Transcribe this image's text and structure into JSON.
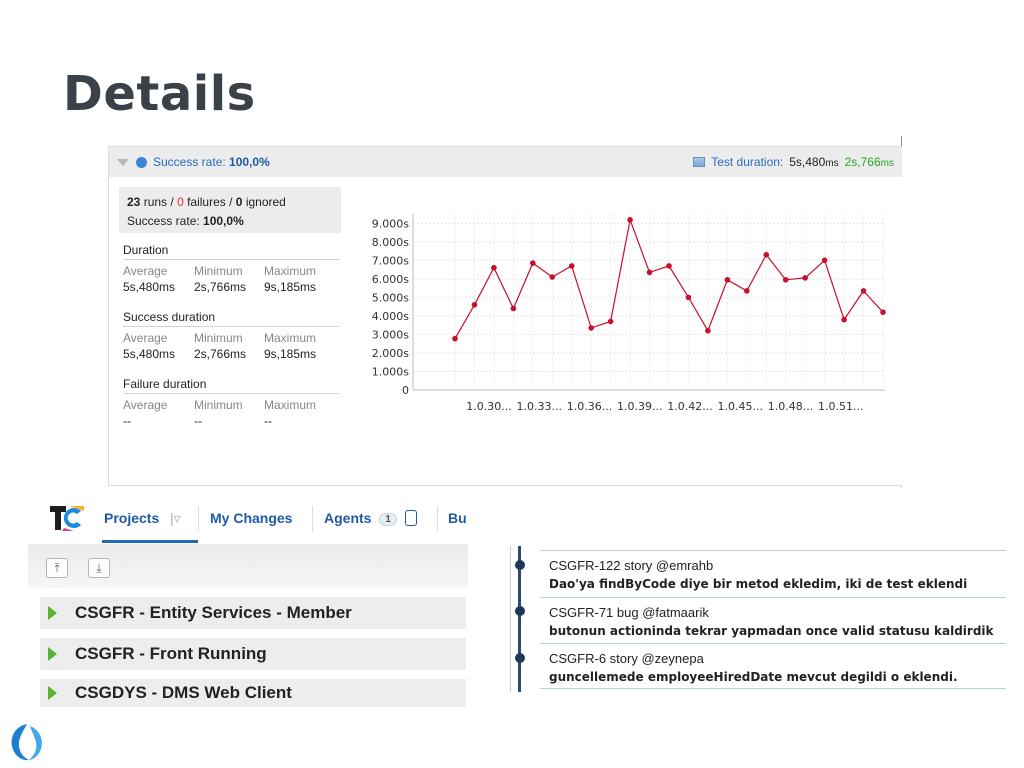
{
  "slide": {
    "title": "Details"
  },
  "panel": {
    "header": {
      "success_label": "Success rate:",
      "success_value": "100,0%",
      "duration_label": "Test duration:",
      "duration_avg": "5s,480",
      "duration_avg_unit": "ms",
      "duration_min": "2s,766",
      "duration_min_unit": "ms"
    },
    "summary": {
      "runs": "23",
      "runs_label": "runs /",
      "failures": "0",
      "failures_label": "failures /",
      "ignored": "0",
      "ignored_label": "ignored",
      "success_label": "Success rate:",
      "success_value": "100,0%"
    },
    "stats": [
      {
        "title": "Duration",
        "headers": [
          "Average",
          "Minimum",
          "Maximum"
        ],
        "values": [
          "5s,480ms",
          "2s,766ms",
          "9s,185ms"
        ]
      },
      {
        "title": "Success duration",
        "headers": [
          "Average",
          "Minimum",
          "Maximum"
        ],
        "values": [
          "5s,480ms",
          "2s,766ms",
          "9s,185ms"
        ]
      },
      {
        "title": "Failure duration",
        "headers": [
          "Average",
          "Minimum",
          "Maximum"
        ],
        "values": [
          "--",
          "--",
          "--"
        ]
      }
    ]
  },
  "chart_data": {
    "type": "line",
    "x_tick_labels": [
      "1.0.30...",
      "1.0.33...",
      "1.0.36...",
      "1.0.39...",
      "1.0.42...",
      "1.0.45...",
      "1.0.48...",
      "1.0.51..."
    ],
    "y_tick_labels": [
      "0",
      "1.000s",
      "2.000s",
      "3.000s",
      "4.000s",
      "5.000s",
      "6.000s",
      "7.000s",
      "8.000s",
      "9.000s"
    ],
    "ylim": [
      0,
      9.5
    ],
    "grid": true,
    "series": [
      {
        "color": "#c8102e",
        "values": [
          2.77,
          4.6,
          6.6,
          4.4,
          6.85,
          6.1,
          6.7,
          3.35,
          3.7,
          9.185,
          6.35,
          6.7,
          5.0,
          3.2,
          5.95,
          5.35,
          7.3,
          5.95,
          6.05,
          7.0,
          3.8,
          5.35,
          4.2
        ]
      }
    ]
  },
  "teamcity": {
    "tabs": [
      "Projects",
      "My Changes",
      "Agents",
      "Bu"
    ],
    "agents_count": "1",
    "toolbar_icons": [
      "collapse-all-icon",
      "expand-all-icon"
    ],
    "projects": [
      "CSGFR - Entity Services - Member",
      "CSGFR - Front Running",
      "CSGDYS - DMS Web Client"
    ]
  },
  "timeline": [
    {
      "title": "CSGFR-122 story @emrahb",
      "message": "Dao'ya findByCode diye bir metod ekledim, iki de test eklendi"
    },
    {
      "title": "CSGFR-71 bug @fatmaarik",
      "message": "butonun actioninda tekrar yapmadan once valid statusu kaldirdik"
    },
    {
      "title": "CSGFR-6 story @zeynepa",
      "message": "guncellemede employeeHiredDate mevcut degildi o eklendi."
    }
  ]
}
